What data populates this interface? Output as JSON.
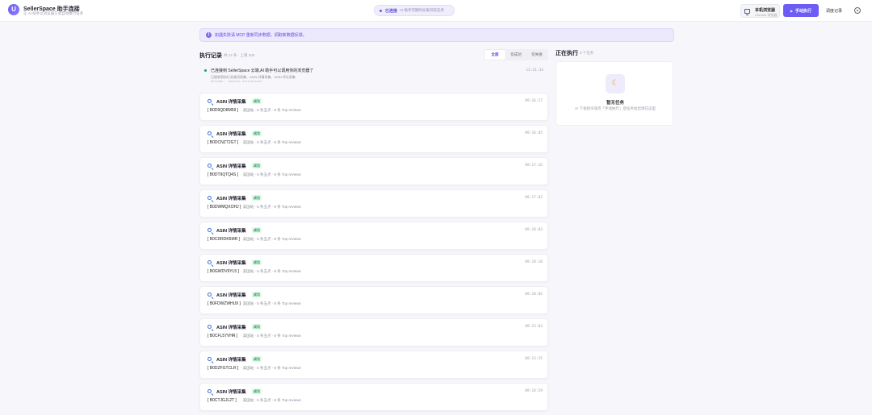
{
  "header": {
    "logo_letter": "U",
    "title": "SellerSpace 助手连接",
    "subtitle": "让 AI 助手以浏览器方式自动执行任务",
    "connection": {
      "status": "已连接",
      "text": "AI 助手可随时派发浏览任务"
    },
    "browser": {
      "title": "本机浏览器",
      "subtitle": "Chrome 浏览器"
    },
    "run_button": "手动执行",
    "history_link": "调度记录"
  },
  "notice": {
    "icon": "i",
    "text": "如遇失败请 MCP 重新同步数据，调取新数据反馈。"
  },
  "records": {
    "title": "执行记录",
    "count": "共 12 条 · 上限 200",
    "filters": [
      {
        "label": "全部",
        "active": true
      },
      {
        "label": "仅成功",
        "active": false
      },
      {
        "label": "仅失败",
        "active": false
      }
    ],
    "pinned": {
      "title": "已连接到 SellerSpace 云端,AI 助手可以调用你的浏览器了",
      "subtitle": "已接收到执行关键词采集、ASIN 详情采集、ASIN 评论采集",
      "code": "welcome · session initialized",
      "time": "13:51:34"
    },
    "items": [
      {
        "title": "ASIN 详情采集",
        "status": "成功",
        "asin": "[ B0D9QD8M59 ]",
        "detail": "· 美国站 · 5 条五点 · 8 条 Top reviews",
        "time": "09:16:17"
      },
      {
        "title": "ASIN 详情采集",
        "status": "成功",
        "asin": "[ B0DCNZT2GT ]",
        "detail": "· 美国站 · 5 条五点 · 8 条 Top reviews",
        "time": "09:16:05"
      },
      {
        "title": "ASIN 详情采集",
        "status": "成功",
        "asin": "[ B0DT9QTQ4S ]",
        "detail": "· 美国站 · 5 条五点 · 8 条 Top reviews",
        "time": "09:17:16"
      },
      {
        "title": "ASIN 详情采集",
        "status": "成功",
        "asin": "[ B0DWMQXOHJ ]",
        "detail": "· 美国站 · 5 条五点 · 9 条 Top reviews",
        "time": "09:17:02"
      },
      {
        "title": "ASIN 详情采集",
        "status": "成功",
        "asin": "[ B0CDRDK6MR ]",
        "detail": "· 美国站 · 5 条五点 · 8 条 Top reviews",
        "time": "09:18:03"
      },
      {
        "title": "ASIN 详情采集",
        "status": "成功",
        "asin": "[ B0GWDV9YL5 ]",
        "detail": "· 美国站 · 5 条五点 · 8 条 Top reviews",
        "time": "09:18:10"
      },
      {
        "title": "ASIN 详情采集",
        "status": "成功",
        "asin": "[ B0FDWZWHU9 ]",
        "detail": "· 美国站 · 5 条五点 · 8 条 Top reviews",
        "time": "09:18:05"
      },
      {
        "title": "ASIN 详情采集",
        "status": "成功",
        "asin": "[ B0CFL57VHR ]",
        "detail": "· 美国站 · 5 条五点 · 8 条 Top reviews",
        "time": "09:13:03"
      },
      {
        "title": "ASIN 详情采集",
        "status": "成功",
        "asin": "[ B0DZFGTCLR ]",
        "detail": "· 美国站 · 6 条五点 · 8 条 Top reviews",
        "time": "09:13:15"
      },
      {
        "title": "ASIN 详情采集",
        "status": "成功",
        "asin": "[ B0CTJGJL2T ]",
        "detail": "· 美国站 · 6 条五点 · 8 条 Top reviews",
        "time": "09:14:29"
      }
    ]
  },
  "running": {
    "title": "正在执行",
    "count": "0 个任务",
    "empty_title": "暂无任务",
    "empty_subtitle": "AI 下发指令或点「手动执行」后任务会出现在这里"
  }
}
